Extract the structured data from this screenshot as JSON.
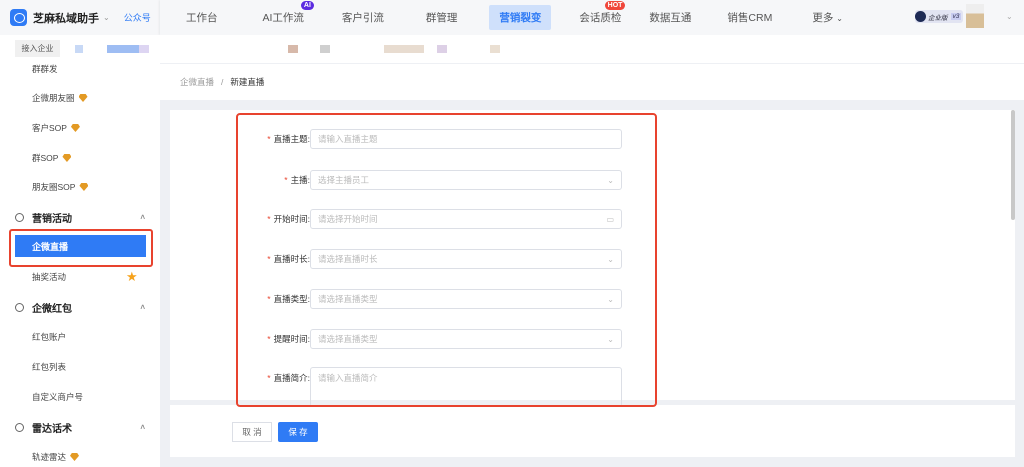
{
  "brand": {
    "name": "芝麻私域助手",
    "account_link": "公众号"
  },
  "nav": [
    {
      "label": "工作台"
    },
    {
      "label": "AI工作流",
      "badge": "AI"
    },
    {
      "label": "客户引流"
    },
    {
      "label": "群管理"
    },
    {
      "label": "营销裂变",
      "active": true
    },
    {
      "label": "会话质检",
      "badge": "HOT"
    },
    {
      "label": "数据互通"
    },
    {
      "label": "销售CRM"
    },
    {
      "label": "更多"
    }
  ],
  "edition": {
    "label": "企业版",
    "version": "v3"
  },
  "enterprise_tab": "接入企业",
  "sidebar": {
    "items_top": [
      {
        "label": "群群发"
      },
      {
        "label": "企微朋友圈",
        "gem": true
      },
      {
        "label": "客户SOP",
        "gem": true
      },
      {
        "label": "群SOP",
        "gem": true
      },
      {
        "label": "朋友圈SOP",
        "gem": true
      }
    ],
    "groups": [
      {
        "label": "营销活动",
        "items": [
          {
            "label": "企微直播",
            "active": true
          },
          {
            "label": "抽奖活动",
            "star": true
          }
        ]
      },
      {
        "label": "企微红包",
        "items": [
          {
            "label": "红包账户"
          },
          {
            "label": "红包列表"
          },
          {
            "label": "自定义商户号"
          }
        ]
      },
      {
        "label": "雷达话术",
        "items": [
          {
            "label": "轨迹雷达",
            "gem": true
          }
        ]
      }
    ]
  },
  "breadcrumb": {
    "parent": "企微直播",
    "separator": "/",
    "current": "新建直播"
  },
  "form": {
    "fields": [
      {
        "label": "直播主题",
        "placeholder": "请输入直播主题",
        "type": "input"
      },
      {
        "label": "主播",
        "placeholder": "选择主播员工",
        "type": "select"
      },
      {
        "label": "开始时间",
        "placeholder": "请选择开始时间",
        "type": "date"
      },
      {
        "label": "直播时长",
        "placeholder": "请选择直播时长",
        "type": "select"
      },
      {
        "label": "直播类型",
        "placeholder": "请选择直播类型",
        "type": "select"
      },
      {
        "label": "提醒时间",
        "placeholder": "请选择直播类型",
        "type": "select"
      },
      {
        "label": "直播简介",
        "placeholder": "请输入直播简介",
        "type": "textarea"
      }
    ]
  },
  "actions": {
    "cancel": "取 消",
    "save": "保 存"
  },
  "colors": {
    "primary": "#2f7bf5",
    "highlight": "#e8432e",
    "gem": "#e39a24"
  }
}
